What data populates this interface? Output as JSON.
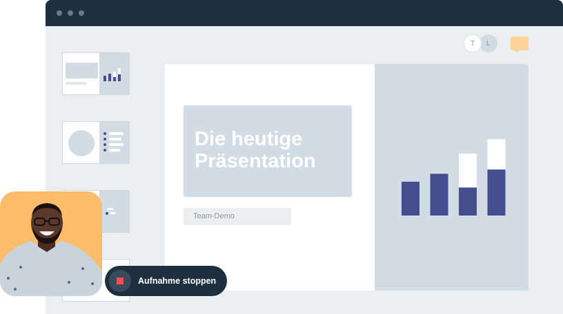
{
  "window": {
    "collaborators": [
      {
        "initial": "T"
      },
      {
        "initial": "L"
      }
    ],
    "chat_icon": "chat-bubble-icon"
  },
  "slide_thumbnails": [
    {
      "name": "title-slide-thumb"
    },
    {
      "name": "list-slide-thumb"
    },
    {
      "name": "diagram-slide-thumb"
    },
    {
      "name": "fourth-slide-thumb"
    }
  ],
  "slide": {
    "title_line1": "Die heutige",
    "title_line2": "Präsentation",
    "subtitle": "Team-Demo"
  },
  "chart_data": {
    "type": "bar",
    "stacked": true,
    "categories": [
      "",
      "",
      "",
      ""
    ],
    "series": [
      {
        "color": "#454f8f",
        "values": [
          47,
          58,
          39,
          64
        ]
      },
      {
        "color": "#ffffff",
        "values": [
          0,
          0,
          47,
          42
        ]
      }
    ],
    "ylim": [
      0,
      110
    ],
    "grid": false,
    "title": "",
    "xlabel": "",
    "ylabel": ""
  },
  "recording": {
    "stop_label": "Aufnahme stoppen",
    "stop_icon": "stop-icon"
  },
  "colors": {
    "titlebar": "#1e2f40",
    "accent_bar": "#454f8f",
    "panel": "#d2dce5",
    "webcam_bg": "#fbbd6a",
    "stop_red": "#f0524a",
    "chat_icon": "#fbd49a"
  }
}
